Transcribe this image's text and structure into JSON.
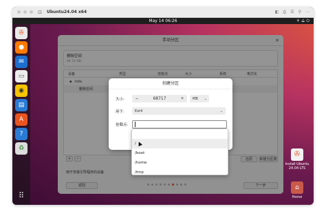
{
  "host": {
    "title": "Ubuntu24.04 x64",
    "tools": [
      "◧",
      "⎙",
      "☰",
      "⚲",
      "⋯"
    ]
  },
  "ubuntu": {
    "clock": "May 14  06:26",
    "tray": "⚘ ⟁ ⏻"
  },
  "dock": {
    "items": [
      {
        "name": "installer",
        "glyph": "✇",
        "color": "#e9e9e9"
      },
      {
        "name": "firefox",
        "glyph": "●",
        "color": "#ff7a00"
      },
      {
        "name": "thunderbird",
        "glyph": "✉",
        "color": "#1f6fcf"
      },
      {
        "name": "files",
        "glyph": "▭",
        "color": "#ececec"
      },
      {
        "name": "rhythmbox",
        "glyph": "◉",
        "color": "#f6c400"
      },
      {
        "name": "writer",
        "glyph": "▤",
        "color": "#2a7bd5"
      },
      {
        "name": "app-center",
        "glyph": "A",
        "color": "#e95420"
      },
      {
        "name": "help",
        "glyph": "?",
        "color": "#2a7bd5"
      },
      {
        "name": "trash",
        "glyph": "♻",
        "color": "#dcdcdc"
      }
    ],
    "apps_glyph": "⠿"
  },
  "desktop": {
    "install_icon_label": "Install Ubuntu\n24.04 LTS",
    "home_icon_label": "Home"
  },
  "installer": {
    "title": "手动分区",
    "close": "✕",
    "disk_name": "删除空间",
    "disk_sub": "64.72 GB",
    "columns": [
      "设备",
      "类型",
      "挂载点",
      "大小",
      "系统",
      "格式化"
    ],
    "rows": [
      "/sda",
      "删除空间"
    ],
    "bootloader_label": "用于安装引导程序的设备",
    "back_button": "返回",
    "next_button": "下一步",
    "revert_button": "还原",
    "new_button": "新建分区表"
  },
  "dialog": {
    "title": "创建分区",
    "size_label": "大小:",
    "size_value": "68717",
    "minus": "−",
    "plus": "+",
    "unit": "MB",
    "use_label": "用于:",
    "use_value": "Ext4",
    "mount_label": "挂载点:",
    "mount_value": ""
  },
  "mount_options": [
    "/",
    "/boot",
    "/home",
    "/tmp"
  ]
}
